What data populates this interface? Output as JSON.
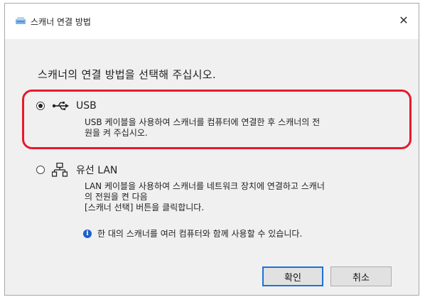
{
  "window": {
    "title": "스캐너 연결 방법",
    "close_label": "✕"
  },
  "instruction": "스캐너의 연결 방법을 선택해 주십시오.",
  "options": [
    {
      "label": "USB",
      "selected": true,
      "icon": "usb-icon",
      "description": [
        "USB 케이블을 사용하여 스캐너를 컴퓨터에 연결한 후 스캐너의 전",
        "원을 켜 주십시오."
      ]
    },
    {
      "label": "유선 LAN",
      "selected": false,
      "icon": "network-icon",
      "description": [
        "LAN 케이블을 사용하여 스캐너를 네트워크 장치에 연결하고 스캐너",
        "의 전원을 켠 다음",
        "[스캐너 선택] 버튼을 클릭합니다."
      ]
    }
  ],
  "info_note": "한 대의 스캐너를 여러 컴퓨터와 함께 사용할 수 있습니다.",
  "buttons": {
    "ok": "확인",
    "cancel": "취소"
  },
  "colors": {
    "highlight": "#e8192c",
    "info_icon": "#1a5fd0",
    "focus_border": "#1a73d9"
  }
}
